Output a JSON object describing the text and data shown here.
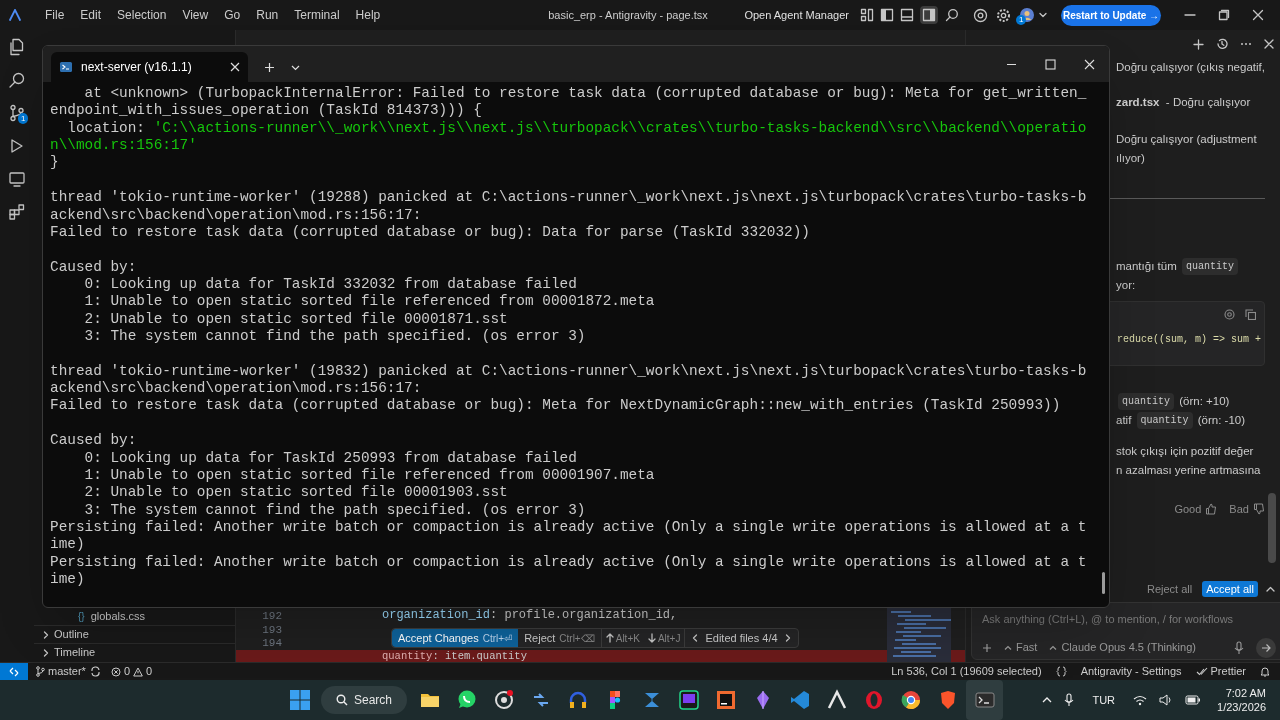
{
  "menu_bar": {
    "menus": [
      "File",
      "Edit",
      "Selection",
      "View",
      "Go",
      "Run",
      "Terminal",
      "Help"
    ],
    "title": "basic_erp - Antigravity - page.tsx",
    "agent_manager": "Open Agent Manager",
    "update_button": "Restart to Update →",
    "account_badge": "1"
  },
  "activity_bar": {
    "scm_badge": "1"
  },
  "sidebar": {
    "items": [
      {
        "kind": "file",
        "icon": "{}",
        "label": "globals.css"
      },
      {
        "kind": "section",
        "label": "Outline",
        "expanded": false
      },
      {
        "kind": "section",
        "label": "Timeline",
        "expanded": false
      }
    ]
  },
  "editor": {
    "lines": [
      {
        "kind": "normal",
        "number": "192",
        "key": "organization_id",
        "value": ": profile.organization_id,"
      },
      {
        "kind": "normal",
        "number": "193"
      },
      {
        "kind": "normal",
        "number": "194"
      },
      {
        "kind": "deleted",
        "key": "quantity",
        "value": ": item.quantity"
      }
    ],
    "review_bar": {
      "accept": "Accept Changes",
      "accept_key": "Ctrl+⏎",
      "reject": "Reject",
      "reject_key": "Ctrl+⌫",
      "prev_key": "Alt+K",
      "next_key": "Alt+J",
      "files": "Edited files 4/4"
    }
  },
  "terminal": {
    "tab_title": "next-server (v16.1.1)",
    "lines": [
      {
        "kind": "text",
        "text": "    at <unknown> (TurbopackInternalError: Failed to restore task data (corrupted database or bug): Meta for get_written_"
      },
      {
        "kind": "text",
        "text": "endpoint_with_issues_operation (TaskId 814373))) {"
      },
      {
        "kind": "mixed",
        "text": "  location: ",
        "string": "'C:\\\\actions-runner\\\\_work\\\\next.js\\\\next.js\\\\turbopack\\\\crates\\\\turbo-tasks-backend\\\\src\\\\backend\\\\operatio"
      },
      {
        "kind": "string",
        "text": "n\\\\mod.rs:156:17'"
      },
      {
        "kind": "text",
        "text": "}"
      },
      {
        "kind": "blank"
      },
      {
        "kind": "text",
        "text": "thread 'tokio-runtime-worker' (19288) panicked at C:\\actions-runner\\_work\\next.js\\next.js\\turbopack\\crates\\turbo-tasks-b"
      },
      {
        "kind": "text",
        "text": "ackend\\src\\backend\\operation\\mod.rs:156:17:"
      },
      {
        "kind": "text",
        "text": "Failed to restore task data (corrupted database or bug): Data for parse (TaskId 332032))"
      },
      {
        "kind": "blank"
      },
      {
        "kind": "text",
        "text": "Caused by:"
      },
      {
        "kind": "text",
        "text": "    0: Looking up data for TaskId 332032 from database failed"
      },
      {
        "kind": "text",
        "text": "    1: Unable to open static sorted file referenced from 00001872.meta"
      },
      {
        "kind": "text",
        "text": "    2: Unable to open static sorted file 00001871.sst"
      },
      {
        "kind": "text",
        "text": "    3: The system cannot find the path specified. (os error 3)"
      },
      {
        "kind": "blank"
      },
      {
        "kind": "text",
        "text": "thread 'tokio-runtime-worker' (19832) panicked at C:\\actions-runner\\_work\\next.js\\next.js\\turbopack\\crates\\turbo-tasks-b"
      },
      {
        "kind": "text",
        "text": "ackend\\src\\backend\\operation\\mod.rs:156:17:"
      },
      {
        "kind": "text",
        "text": "Failed to restore task data (corrupted database or bug): Meta for NextDynamicGraph::new_with_entries (TaskId 250993))"
      },
      {
        "kind": "blank"
      },
      {
        "kind": "text",
        "text": "Caused by:"
      },
      {
        "kind": "text",
        "text": "    0: Looking up data for TaskId 250993 from database failed"
      },
      {
        "kind": "text",
        "text": "    1: Unable to open static sorted file referenced from 00001907.meta"
      },
      {
        "kind": "text",
        "text": "    2: Unable to open static sorted file 00001903.sst"
      },
      {
        "kind": "text",
        "text": "    3: The system cannot find the path specified. (os error 3)"
      },
      {
        "kind": "text",
        "text": "Persisting failed: Another write batch or compaction is already active (Only a single write operations is allowed at a t"
      },
      {
        "kind": "text",
        "text": "ime)"
      },
      {
        "kind": "text",
        "text": "Persisting failed: Another write batch or compaction is already active (Only a single write operations is allowed at a t"
      },
      {
        "kind": "text",
        "text": "ime)"
      }
    ]
  },
  "chat": {
    "rows": [
      {
        "kind": "line",
        "text": "Doğru çalışıyor (çıkış negatif,"
      },
      {
        "kind": "line",
        "text": "**zard.tsx**  - Doğru çalışıyor"
      },
      {
        "kind": "line",
        "text": "Doğru çalışıyor (adjustment"
      },
      {
        "kind": "line",
        "text": "ılıyor)"
      },
      {
        "kind": "divider"
      },
      {
        "kind": "line",
        "text": "mantığı tüm ",
        "code": "quantity"
      },
      {
        "kind": "line",
        "text": "yor:"
      },
      {
        "kind": "code_block",
        "text": "reduce((sum, m) => sum +"
      },
      {
        "kind": "line",
        "code": "quantity",
        "after": " (örn: +10)"
      },
      {
        "kind": "line",
        "text": "atif ",
        "code": "quantity",
        "after": " (örn: -10)"
      },
      {
        "kind": "line",
        "text": "stok çıkışı için pozitif değer"
      },
      {
        "kind": "line",
        "text": "n azalması yerine artmasına"
      }
    ],
    "feedback": {
      "good": "Good",
      "bad": "Bad"
    },
    "reject_all": "Reject all",
    "accept_all": "Accept all",
    "input": {
      "placeholder": "Ask anything (Ctrl+L), @ to mention, / for workflows"
    },
    "mode": "Fast",
    "model": "Claude Opus 4.5 (Thinking)"
  },
  "status_bar": {
    "branch": "master*",
    "errors": "0",
    "warnings": "0",
    "cursor": "Ln 536, Col 1 (19609 selected)",
    "settings": "Antigravity - Settings",
    "formatter": "Prettier"
  },
  "taskbar": {
    "search": "Search",
    "language": "TUR",
    "time": "7:02 AM",
    "date": "1/23/2026"
  }
}
